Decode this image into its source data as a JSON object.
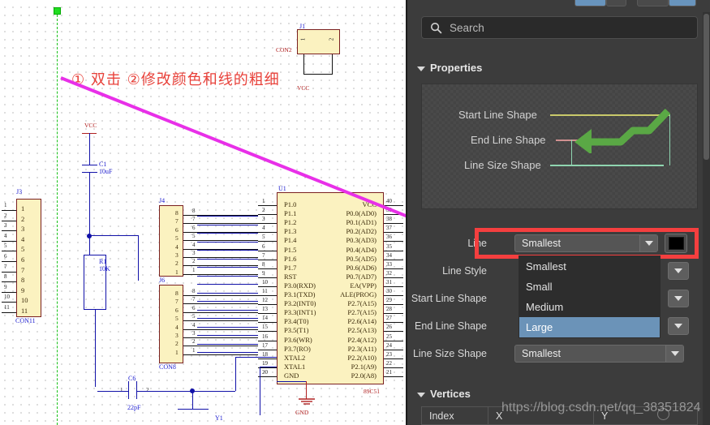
{
  "canvas": {
    "annotation": "① 双击 ②修改颜色和线的粗细",
    "components": [
      {
        "ref": "J1",
        "name": "CON2",
        "pins": [
          "1",
          "2"
        ]
      },
      {
        "ref": "J3",
        "name": "CON11",
        "pins": [
          "1",
          "2",
          "3",
          "4",
          "5",
          "6",
          "7",
          "8",
          "9",
          "10",
          "11"
        ]
      },
      {
        "ref": "J4",
        "name": "",
        "pins": [
          "8",
          "7",
          "6",
          "5",
          "4",
          "3",
          "2",
          "1"
        ]
      },
      {
        "ref": "J6",
        "name": "CON8",
        "pins": [
          "8",
          "7",
          "6",
          "5",
          "4",
          "3",
          "2",
          "1"
        ]
      },
      {
        "ref": "U1",
        "name": "89C51"
      },
      {
        "ref": "C1",
        "value": "10uF"
      },
      {
        "ref": "C6",
        "value": "22pF"
      },
      {
        "ref": "R1",
        "value": "10K"
      },
      {
        "ref": "Y1",
        "value": ""
      }
    ],
    "net_labels": [
      "VCC",
      "VCC",
      "GND"
    ],
    "ic": {
      "ref": "U1",
      "part": "89C51",
      "left_pins": [
        {
          "num": "1",
          "label": "P1.0"
        },
        {
          "num": "2",
          "label": "P1.1"
        },
        {
          "num": "3",
          "label": "P1.2"
        },
        {
          "num": "4",
          "label": "P1.3"
        },
        {
          "num": "5",
          "label": "P1.4"
        },
        {
          "num": "6",
          "label": "P1.5"
        },
        {
          "num": "7",
          "label": "P1.6"
        },
        {
          "num": "8",
          "label": "P1.7"
        },
        {
          "num": "9",
          "label": "RST"
        },
        {
          "num": "10",
          "label": "P3.0(RXD)"
        },
        {
          "num": "11",
          "label": "P3.1(TXD)"
        },
        {
          "num": "12",
          "label": "P3.2(INT0)"
        },
        {
          "num": "13",
          "label": "P3.3(INT1)"
        },
        {
          "num": "14",
          "label": "P3.4(T0)"
        },
        {
          "num": "15",
          "label": "P3.5(T1)"
        },
        {
          "num": "16",
          "label": "P3.6(WR)"
        },
        {
          "num": "17",
          "label": "P3.7(RO)"
        },
        {
          "num": "18",
          "label": "XTAL2"
        },
        {
          "num": "19",
          "label": "XTAL1"
        },
        {
          "num": "20",
          "label": "GND"
        }
      ],
      "right_pins": [
        {
          "num": "40",
          "label": "VCC"
        },
        {
          "num": "39",
          "label": "P0.0(AD0)"
        },
        {
          "num": "38",
          "label": "P0.1(AD1)"
        },
        {
          "num": "37",
          "label": "P0.2(AD2)"
        },
        {
          "num": "36",
          "label": "P0.3(AD3)"
        },
        {
          "num": "35",
          "label": "P0.4(AD4)"
        },
        {
          "num": "34",
          "label": "P0.5(AD5)"
        },
        {
          "num": "33",
          "label": "P0.6(AD6)"
        },
        {
          "num": "32",
          "label": "P0.7(AD7)"
        },
        {
          "num": "31",
          "label": "EA(VPP)"
        },
        {
          "num": "30",
          "label": "ALE(PROG)"
        },
        {
          "num": "29",
          "label": "P2.7(A15)"
        },
        {
          "num": "28",
          "label": "P2.7(A15)"
        },
        {
          "num": "27",
          "label": "P2.6(A14)"
        },
        {
          "num": "26",
          "label": "P2.5(A13)"
        },
        {
          "num": "25",
          "label": "P2.4(A12)"
        },
        {
          "num": "24",
          "label": "P2.3(A11)"
        },
        {
          "num": "23",
          "label": "P2.2(A10)"
        },
        {
          "num": "22",
          "label": "P2.1(A9)"
        },
        {
          "num": "21",
          "label": "P2.0(A8)"
        }
      ]
    }
  },
  "panel": {
    "search": {
      "placeholder": "Search",
      "value": ""
    },
    "properties_header": "Properties",
    "vertices_header": "Vertices",
    "preview": {
      "labels": [
        "Start Line Shape",
        "End Line Shape",
        "Line Size Shape"
      ],
      "colors": {
        "start": "#c9c96a",
        "end": "#d09090",
        "size": "#8fd5b0",
        "arrow": "#5aa845"
      }
    },
    "rows": [
      {
        "label": "Line",
        "value": "Smallest"
      },
      {
        "label": "Line Style",
        "value": ""
      },
      {
        "label": "Start Line Shape",
        "value": ""
      },
      {
        "label": "End Line Shape",
        "value": ""
      },
      {
        "label": "Line Size Shape",
        "value": "Smallest"
      }
    ],
    "dropdown": {
      "options": [
        "Smallest",
        "Small",
        "Medium",
        "Large"
      ],
      "selected": "Large"
    },
    "color_value": "#000000",
    "highlight_color": "#f43f3f",
    "vertices_columns": [
      "Index",
      "X",
      "Y"
    ]
  },
  "watermark": {
    "text": "https://blog.csdn.net/qq_38351824"
  }
}
